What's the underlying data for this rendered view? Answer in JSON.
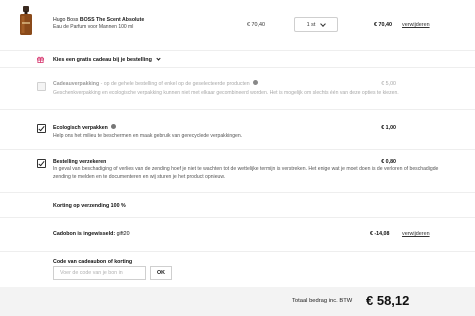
{
  "product": {
    "brand": "Hugo Boss",
    "name": "BOSS The Scent Absolute",
    "variant": "Eau de Parfum voor Mannen 100 ml",
    "unit_price": "€ 70,40",
    "quantity": "1 st",
    "line_total": "€ 70,40",
    "remove_label": "verwijderen",
    "bottle_color": "#8a4a1a",
    "cap_color": "#3a2a20"
  },
  "gift": {
    "label": "Kies een gratis cadeau bij je bestelling",
    "icon": "gift-icon",
    "icon_color": "#d6336c"
  },
  "options": {
    "giftwrap": {
      "title": "Cadeauverpakking",
      "title_suffix": " - op de gehele bestelling of enkel op de geselecteerde producten",
      "description": "Geschenkverpakking en ecologische verpakking kunnen niet met elkaar gecombineerd worden. Het is mogelijk om slechts één van deze opties te kiezen.",
      "price": "€ 5,00",
      "checked": false,
      "disabled": true
    },
    "eco": {
      "title": "Ecologisch verpakken",
      "description": "Help ons het milieu te beschermen en maak gebruik van gerecyclede verpakkingen.",
      "price": "€ 1,00",
      "checked": true
    },
    "insurance": {
      "title": "Bestelling verzekeren",
      "description": "In geval van beschadiging of verlies van de zending hoef je niet te wachten tot de wettelijke termijn is verstreken. Het enige wat je moet doen is de verloren of beschadigde zending te melden en te documenteren en wij sturen je het product opnieuw.",
      "price": "€ 0,80",
      "checked": true
    }
  },
  "shipping_discount": {
    "label": "Korting op verzending 100 %"
  },
  "giftcard": {
    "label": "Cadobon is ingewisseld:",
    "code": "gift20",
    "amount": "€ -14,08",
    "remove_label": "verwijderen"
  },
  "voucher": {
    "label": "Code van cadeaubon of korting",
    "placeholder": "Voer de code van je bon in",
    "value": "",
    "ok_label": "OK"
  },
  "total": {
    "label": "Totaal bedrag inc. BTW",
    "value": "€ 58,12"
  }
}
